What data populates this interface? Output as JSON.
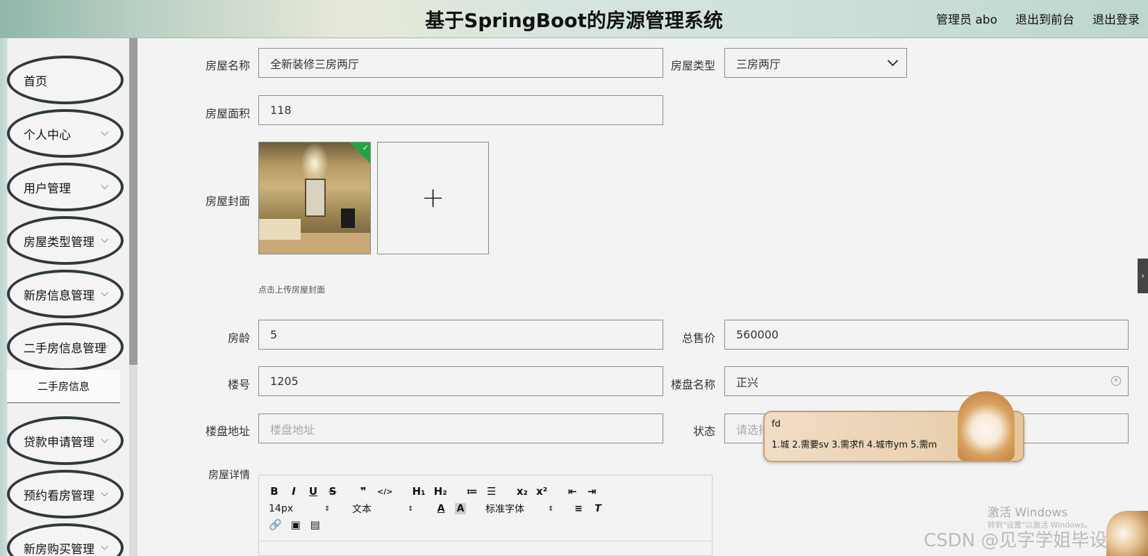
{
  "header": {
    "title": "基于SpringBoot的房源管理系统",
    "admin": "管理员 abo",
    "to_front": "退出到前台",
    "logout": "退出登录"
  },
  "sidebar": {
    "items": [
      {
        "label": "首页"
      },
      {
        "label": "个人中心"
      },
      {
        "label": "用户管理"
      },
      {
        "label": "房屋类型管理"
      },
      {
        "label": "新房信息管理"
      },
      {
        "label": "二手房信息管理"
      },
      {
        "label": "贷款申请管理"
      },
      {
        "label": "预约看房管理"
      },
      {
        "label": "新房购买管理"
      }
    ],
    "submenu": "二手房信息",
    "chevron": "⌵"
  },
  "form": {
    "house_name": {
      "label": "房屋名称",
      "value": "全新装修三房两厅"
    },
    "house_type": {
      "label": "房屋类型",
      "value": "三房两厅"
    },
    "area": {
      "label": "房屋面积",
      "value": "118"
    },
    "cover": {
      "label": "房屋封面",
      "hint": "点击上传房屋封面",
      "plus": "+",
      "check": "✓"
    },
    "age": {
      "label": "房龄",
      "value": "5"
    },
    "total_price": {
      "label": "总售价",
      "value": "560000"
    },
    "building_no": {
      "label": "楼号",
      "value": "1205"
    },
    "estate_name": {
      "label": "楼盘名称",
      "value": "正兴"
    },
    "estate_address": {
      "label": "楼盘地址",
      "placeholder": "楼盘地址"
    },
    "status": {
      "label": "状态",
      "placeholder": "请选择"
    },
    "detail": {
      "label": "房屋详情"
    }
  },
  "editor": {
    "row1": [
      "B",
      "I",
      "U",
      "S",
      "❞",
      "</>",
      "H₁",
      "H₂",
      "≔",
      "☰",
      "x₂",
      "x²",
      "⇤",
      "⇥"
    ],
    "font_size": "14px",
    "block": "文本",
    "font_family": "标准字体",
    "row3": [
      "🔗",
      "▣",
      "▤"
    ]
  },
  "ime": {
    "code": "fd",
    "candidates": "1.城  2.需要sv  3.需求fi  4.城市ym  5.需m"
  },
  "watermark": {
    "activate": "激活 Windows",
    "activate_sub": "转到\"设置\"以激活 Windows。",
    "csdn": "CSDN @见字学姐毕设"
  },
  "icons": {
    "side_tab": "›"
  }
}
